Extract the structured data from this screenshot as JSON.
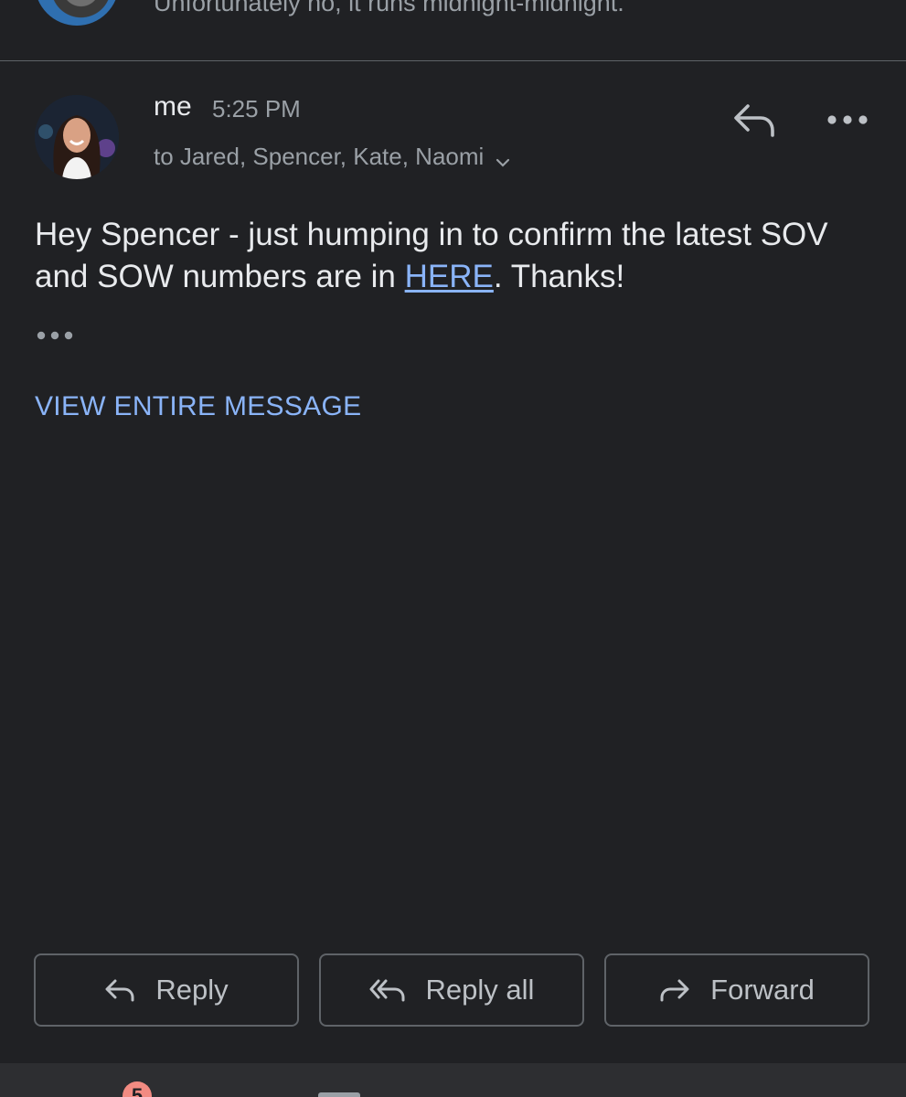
{
  "previous_message": {
    "snippet": "Unfortunately no, it runs midnight-midnight."
  },
  "message": {
    "sender": "me",
    "time": "5:25 PM",
    "recipients": "to Jared, Spencer, Kate, Naomi",
    "body_before_link": "Hey Spencer - just humping in to confirm the latest SOV and SOW numbers are in ",
    "link_text": "HERE",
    "body_after_link": ". Thanks!",
    "view_entire_label": "VIEW ENTIRE MESSAGE"
  },
  "actions": {
    "reply_label": "Reply",
    "reply_all_label": "Reply all",
    "forward_label": "Forward"
  },
  "bottom_nav": {
    "badge_count": "5"
  },
  "colors": {
    "background": "#202124",
    "link": "#8ab4f8",
    "secondary_text": "#9aa0a6",
    "badge": "#f28b82"
  },
  "icons": [
    "reply-icon",
    "more-vert-icon",
    "chevron-down-icon",
    "reply-all-icon",
    "forward-icon"
  ]
}
